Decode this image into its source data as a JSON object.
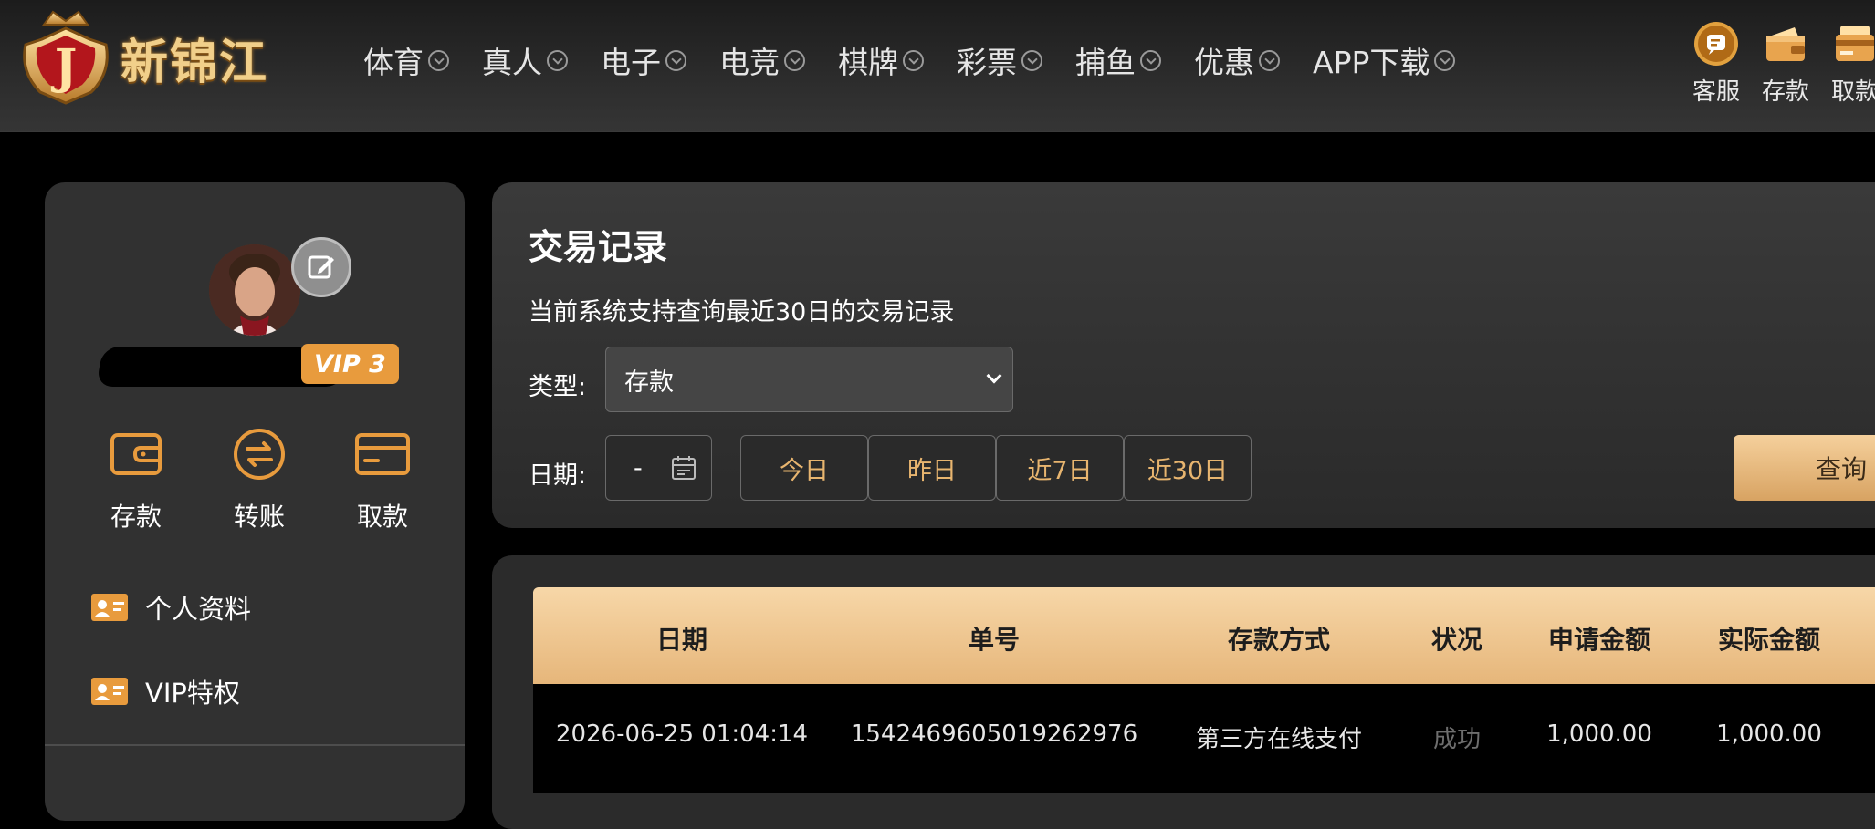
{
  "brand": {
    "name": "新锦江",
    "emblem_letter": "J"
  },
  "nav": [
    {
      "label": "体育"
    },
    {
      "label": "真人"
    },
    {
      "label": "电子"
    },
    {
      "label": "电竞"
    },
    {
      "label": "棋牌"
    },
    {
      "label": "彩票"
    },
    {
      "label": "捕鱼"
    },
    {
      "label": "优惠"
    },
    {
      "label": "APP下载"
    }
  ],
  "top_actions": [
    {
      "label": "客服",
      "icon": "customer-service-icon"
    },
    {
      "label": "存款",
      "icon": "wallet-icon"
    },
    {
      "label": "取款",
      "icon": "withdraw-icon"
    }
  ],
  "user": {
    "vip_label": "VIP 3"
  },
  "quick_actions": [
    {
      "label": "存款",
      "icon": "wallet-icon"
    },
    {
      "label": "转账",
      "icon": "transfer-icon"
    },
    {
      "label": "取款",
      "icon": "card-icon"
    }
  ],
  "side_menu": [
    {
      "label": "个人资料",
      "icon": "id-card-icon"
    },
    {
      "label": "VIP特权",
      "icon": "id-card-icon"
    }
  ],
  "filter": {
    "title": "交易记录",
    "subtitle": "当前系统支持查询最近30日的交易记录",
    "type_label": "类型:",
    "type_value": "存款",
    "date_label": "日期:",
    "date_value": "-",
    "date_buttons": [
      "今日",
      "昨日",
      "近7日",
      "近30日"
    ],
    "query_label": "查询"
  },
  "table": {
    "headers": [
      "日期",
      "单号",
      "存款方式",
      "状况",
      "申请金额",
      "实际金额"
    ],
    "rows": [
      [
        "2026-06-25 01:04:14",
        "154246960501926297​6",
        "第三方在线支付",
        "成功",
        "1,000.00",
        "1,000.00"
      ]
    ]
  },
  "colors": {
    "accent": "#e8b56f",
    "vip": "#e89b3d",
    "header_gold": "#f0c68a"
  }
}
